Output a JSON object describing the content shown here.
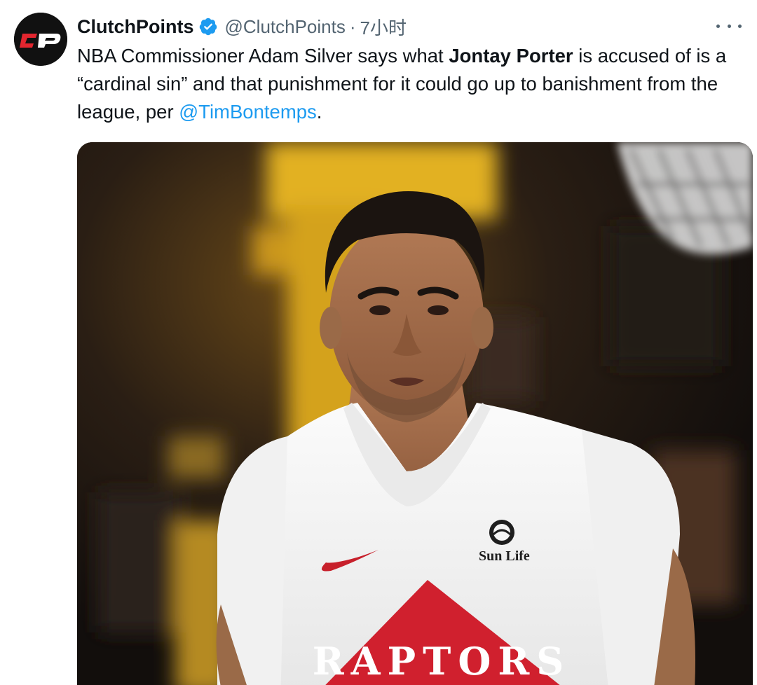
{
  "tweet": {
    "display_name": "ClutchPoints",
    "handle": "@ClutchPoints",
    "separator": "·",
    "time": "7小时",
    "verified_icon": "verified-badge-icon",
    "avatar_text": "CP",
    "more_icon": "more-dots-icon",
    "text": {
      "part1": "NBA Commissioner Adam Silver says what ",
      "bold": "Jontay Porter",
      "part2": " is accused of is a “cardinal sin” and that punishment for it could go up to banishment from the league, per ",
      "mention": "@TimBontemps",
      "part3": "."
    },
    "media": {
      "sponsor_text": "Sun Life",
      "jersey_text": "RAPTORS"
    }
  },
  "colors": {
    "link": "#1d9bf0",
    "secondary": "#536471",
    "verified": "#1d9bf0",
    "avatar_red": "#e3262f",
    "jersey_red": "#d0202e"
  }
}
